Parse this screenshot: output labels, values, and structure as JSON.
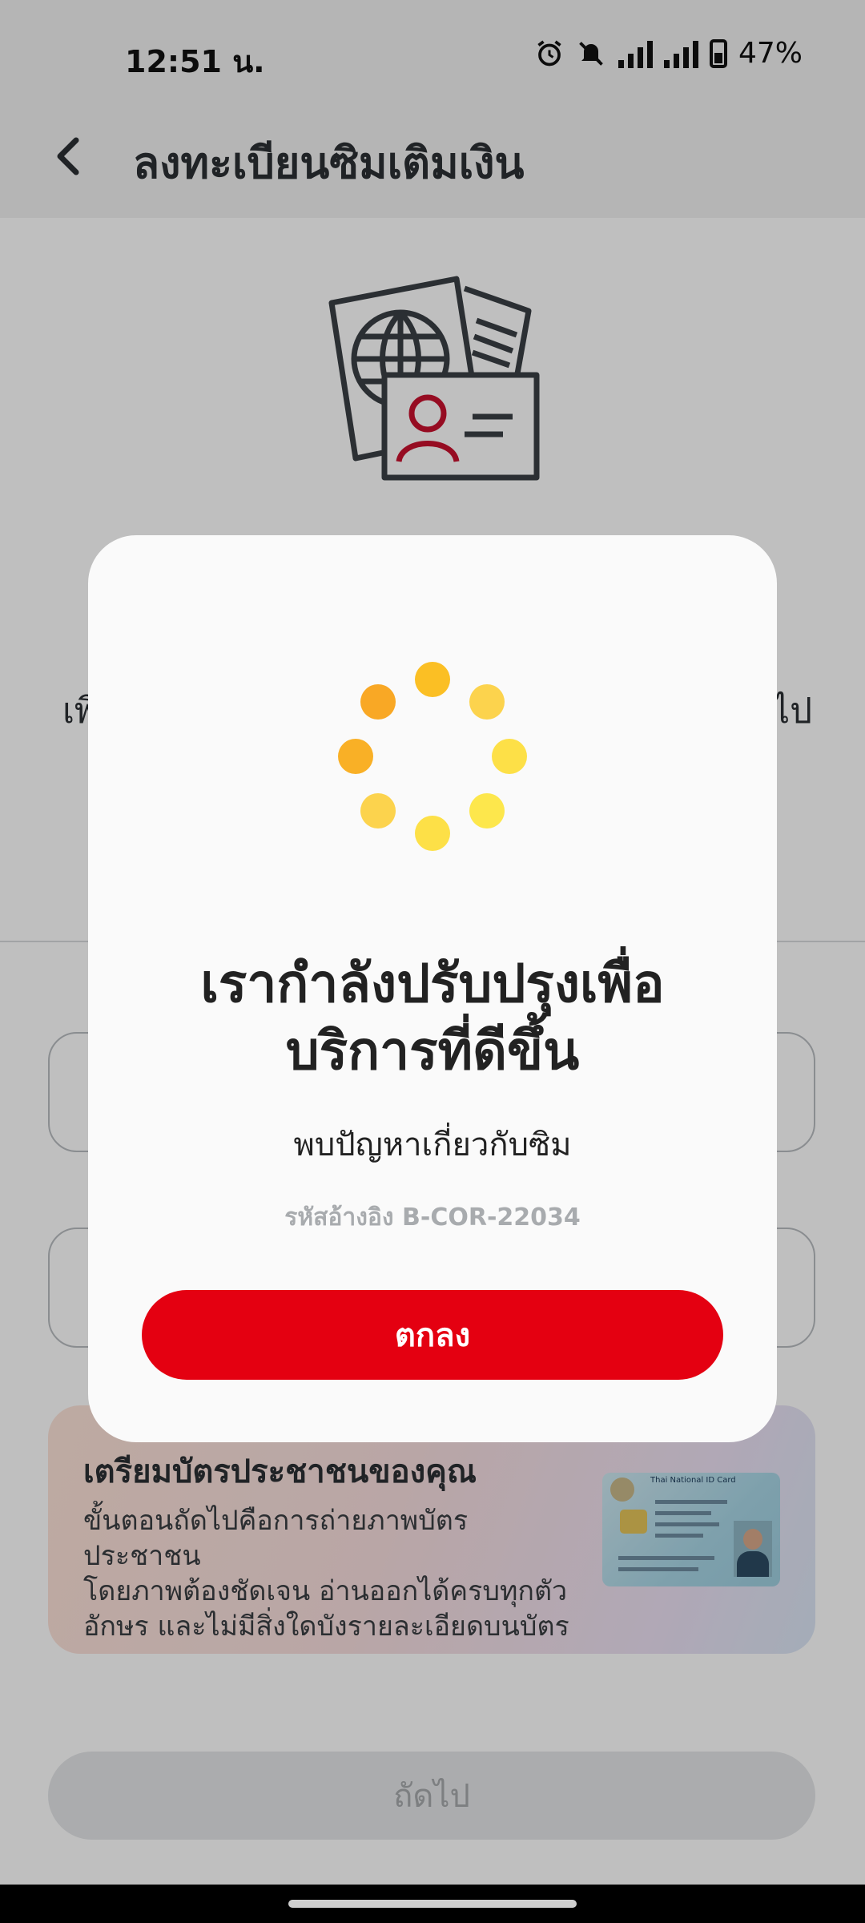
{
  "status_bar": {
    "time": "12:51 น.",
    "battery": "47%",
    "icons": [
      "alarm-icon",
      "mute-icon",
      "signal-icon",
      "signal-icon",
      "battery-icon"
    ]
  },
  "header": {
    "back_icon": "chevron-left-icon",
    "title": "ลงทะเบียนซิมเติมเงิน"
  },
  "background": {
    "hero_icon": "passport-id-card-icon",
    "partial_left_text": "เพิ",
    "partial_right_text": "ไป",
    "promo": {
      "title": "เตรียมบัตรประชาชนของคุณ",
      "body_lines": [
        "ขั้นตอนถัดไปคือการถ่ายภาพบัตรประชาชน",
        "โดยภาพต้องชัดเจน อ่านออกได้ครบทุกตัว",
        "อักษร และไม่มีสิ่งใดบังรายละเอียดบนบัตร"
      ],
      "card_title": "Thai National ID Card"
    },
    "next_button": "ถัดไป"
  },
  "modal": {
    "spinner_icon": "loading-spinner-icon",
    "title_lines": [
      "เรากำลังปรับปรุงเพื่อ",
      "บริการที่ดีขึ้น"
    ],
    "message": "พบปัญหาเกี่ยวกับซิม",
    "reference": "รหัสอ้างอิง B-COR-22034",
    "ok_button": "ตกลง"
  },
  "colors": {
    "primary_red": "#e40011",
    "spinner_orange": "#f9a825",
    "spinner_yellow": "#fde74c"
  }
}
